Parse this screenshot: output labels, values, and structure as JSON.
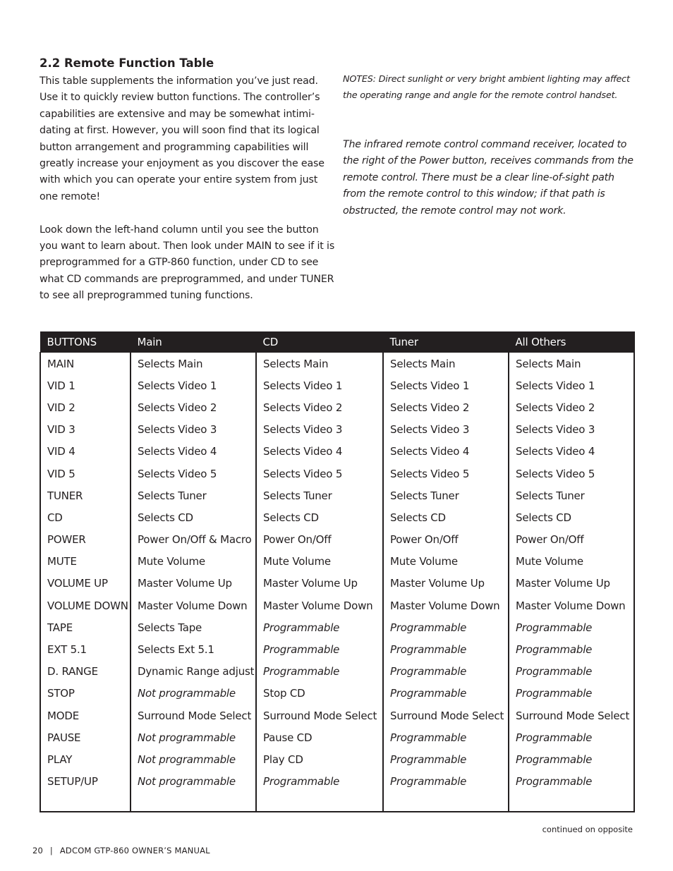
{
  "section_title": "2.2 Remote Function Table",
  "intro": {
    "paragraphs": [
      "This table supplements the information you’ve just read. Use it to quickly review button functions. The controller’s capabilities are extensive and may be somewhat intimi-dating at first. However, you will soon find that its logical button arrangement and programming capabilities will greatly increase your enjoyment as you discover the ease with which you can operate your entire system from just one remote!",
      "Look down the left-hand column until you see the button you want to learn about. Then look under MAIN to see if it is preprogrammed for a GTP-860 function, under CD to see what CD commands are preprogrammed, and under TUNER to see all preprogrammed tuning functions."
    ]
  },
  "notes": {
    "note1": "NOTES: Direct sunlight or very bright ambient lighting may affect the operating range and angle for the remote control handset.",
    "note2": "The infrared remote control command receiver, located to the right of the Power button, receives commands from the remote control. There must be a clear line-of-sight path from the remote control to this window; if that path is obstructed, the remote control may not work."
  },
  "table": {
    "headers": [
      "BUTTONS",
      "Main",
      "CD",
      "Tuner",
      "All Others"
    ],
    "rows": [
      [
        "MAIN",
        "Selects Main",
        "Selects Main",
        "Selects Main",
        "Selects Main"
      ],
      [
        "VID 1",
        "Selects Video 1",
        "Selects Video 1",
        "Selects Video 1",
        "Selects Video 1"
      ],
      [
        "VID 2",
        "Selects Video 2",
        "Selects Video 2",
        "Selects Video 2",
        "Selects Video 2"
      ],
      [
        "VID 3",
        "Selects Video 3",
        "Selects Video 3",
        "Selects Video 3",
        "Selects Video 3"
      ],
      [
        "VID 4",
        "Selects Video 4",
        "Selects Video 4",
        "Selects Video 4",
        "Selects Video 4"
      ],
      [
        "VID 5",
        "Selects Video 5",
        "Selects Video 5",
        "Selects Video 5",
        "Selects Video 5"
      ],
      [
        "TUNER",
        "Selects Tuner",
        "Selects Tuner",
        "Selects Tuner",
        "Selects Tuner"
      ],
      [
        "CD",
        "Selects CD",
        "Selects CD",
        "Selects CD",
        "Selects CD"
      ],
      [
        "POWER",
        "Power On/Off & Macro",
        "Power On/Off",
        "Power On/Off",
        "Power On/Off"
      ],
      [
        "MUTE",
        "Mute Volume",
        "Mute Volume",
        "Mute Volume",
        "Mute Volume"
      ],
      [
        "VOLUME UP",
        "Master Volume Up",
        "Master Volume Up",
        "Master Volume Up",
        "Master Volume Up"
      ],
      [
        "VOLUME DOWN",
        "Master Volume Down",
        "Master Volume Down",
        "Master Volume Down",
        "Master Volume Down"
      ],
      [
        "TAPE",
        "Selects Tape",
        "Programmable",
        "Programmable",
        "Programmable"
      ],
      [
        "EXT 5.1",
        "Selects Ext 5.1",
        "Programmable",
        "Programmable",
        "Programmable"
      ],
      [
        "D. RANGE",
        "Dynamic Range adjust",
        "Programmable",
        "Programmable",
        "Programmable"
      ],
      [
        "STOP",
        "Not programmable",
        "Stop CD",
        "Programmable",
        "Programmable"
      ],
      [
        "MODE",
        "Surround Mode Select",
        "Surround Mode Select",
        "Surround Mode Select",
        "Surround Mode Select"
      ],
      [
        "PAUSE",
        "Not programmable",
        "Pause CD",
        "Programmable",
        "Programmable"
      ],
      [
        "PLAY",
        "Not programmable",
        "Play CD",
        "Programmable",
        "Programmable"
      ],
      [
        "SETUP/UP",
        "Not programmable",
        "Programmable",
        "Programmable",
        "Programmable"
      ]
    ],
    "italic_values": [
      "Programmable",
      "Not programmable"
    ]
  },
  "continued_note": "continued on opposite",
  "footer": {
    "page_number": "20",
    "separator": "|",
    "manual_title": "ADCOM GTP-860 OWNER’S MANUAL"
  }
}
